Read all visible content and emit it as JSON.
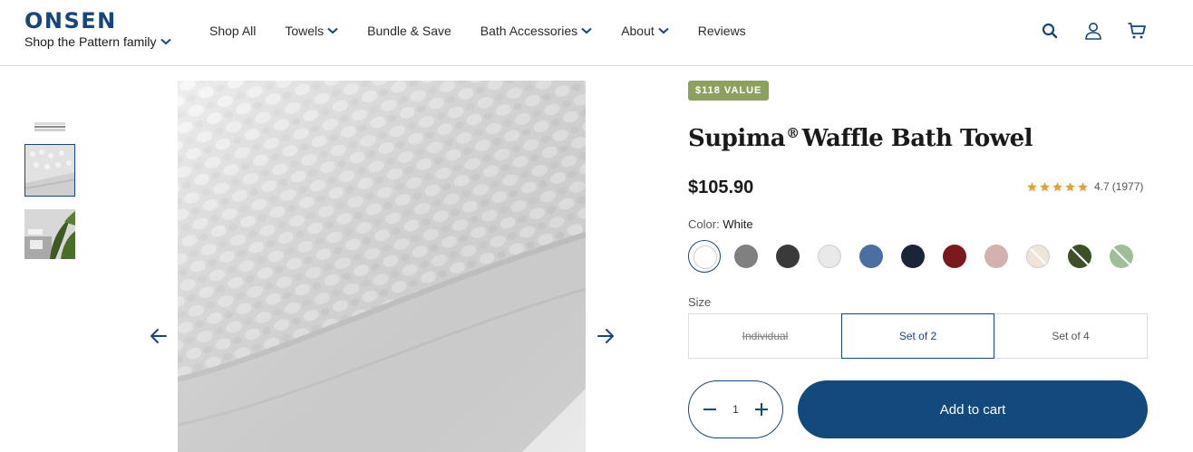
{
  "header": {
    "logo": "ONSEN",
    "family_label": "Shop the Pattern family",
    "nav": [
      {
        "label": "Shop All",
        "dropdown": false
      },
      {
        "label": "Towels",
        "dropdown": true
      },
      {
        "label": "Bundle & Save",
        "dropdown": false
      },
      {
        "label": "Bath Accessories",
        "dropdown": true
      },
      {
        "label": "About",
        "dropdown": true
      },
      {
        "label": "Reviews",
        "dropdown": false
      }
    ],
    "icons": [
      "search-icon",
      "account-icon",
      "cart-icon"
    ]
  },
  "gallery": {
    "thumbnails": [
      "folded-towel-thumbnail",
      "waffle-texture-thumbnail",
      "bathroom-plant-thumbnail"
    ],
    "selected_thumbnail": 1,
    "main_image": "waffle-towel-closeup",
    "prev_icon": "arrow-left-icon",
    "next_icon": "arrow-right-icon"
  },
  "product": {
    "badge": "$118 VALUE",
    "title": "Supima",
    "title_mark": "®",
    "title_rest": "Waffle Bath Towel",
    "price": "$105.90",
    "rating": "4.7",
    "review_count": "(1977)",
    "star_count": 5,
    "color_label": "Color:",
    "color_value": "White",
    "swatches": [
      {
        "name": "White",
        "hex": "#ffffff",
        "sold_out": false,
        "selected": true
      },
      {
        "name": "Gray",
        "hex": "#808080",
        "sold_out": false,
        "selected": false
      },
      {
        "name": "Charcoal",
        "hex": "#3a3a3a",
        "sold_out": false,
        "selected": false
      },
      {
        "name": "Light Gray",
        "hex": "#e9e9e9",
        "sold_out": false,
        "selected": false
      },
      {
        "name": "Blue",
        "hex": "#4a6fa0",
        "sold_out": false,
        "selected": false
      },
      {
        "name": "Navy",
        "hex": "#1b2538",
        "sold_out": false,
        "selected": false
      },
      {
        "name": "Red",
        "hex": "#7a1a1c",
        "sold_out": false,
        "selected": false
      },
      {
        "name": "Blush",
        "hex": "#d4b1ae",
        "sold_out": false,
        "selected": false
      },
      {
        "name": "Cream",
        "hex": "#efe4d8",
        "sold_out": true,
        "selected": false
      },
      {
        "name": "Olive",
        "hex": "#3d5028",
        "sold_out": true,
        "selected": false
      },
      {
        "name": "Sage",
        "hex": "#9ebf98",
        "sold_out": true,
        "selected": false
      }
    ],
    "size_label": "Size",
    "sizes": [
      {
        "label": "Individual",
        "disabled": true,
        "selected": false
      },
      {
        "label": "Set of 2",
        "disabled": false,
        "selected": true
      },
      {
        "label": "Set of 4",
        "disabled": false,
        "selected": false
      }
    ],
    "quantity": "1",
    "add_to_cart": "Add to cart"
  },
  "colors": {
    "brand": "#17467a",
    "button": "#124a7e",
    "badge": "#8da15f",
    "star": "#e0a43a"
  }
}
